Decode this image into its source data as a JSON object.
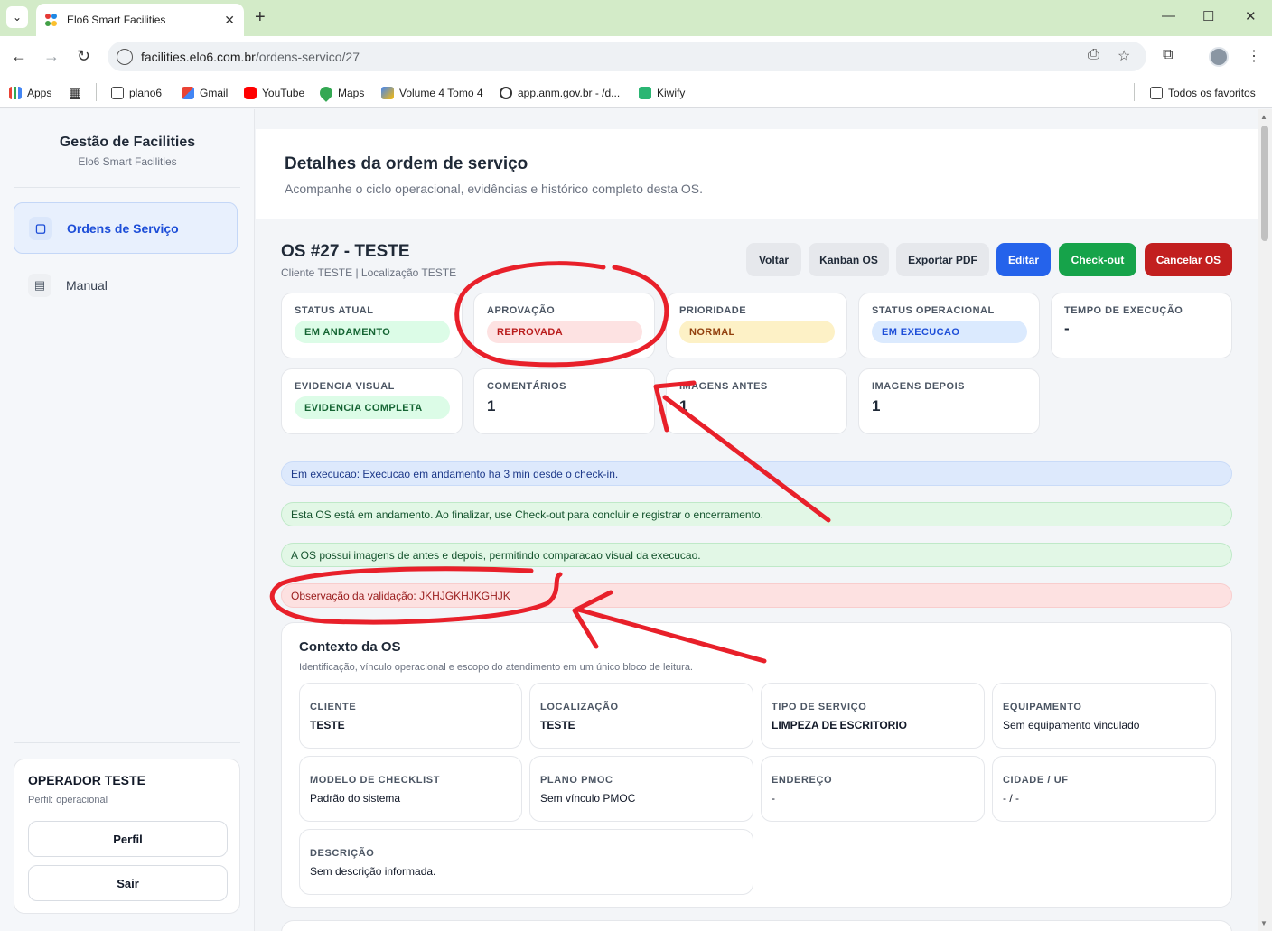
{
  "browser": {
    "tab_title": "Elo6 Smart Facilities",
    "url_host": "facilities.elo6.com.br",
    "url_path": "/ordens-servico/27",
    "bookmarks": [
      "Apps",
      "plano6",
      "Gmail",
      "YouTube",
      "Maps",
      "Volume 4 Tomo 4",
      "app.anm.gov.br - /d...",
      "Kiwify"
    ],
    "all_bookmarks": "Todos os favoritos"
  },
  "sidebar": {
    "title": "Gestão de Facilities",
    "subtitle": "Elo6 Smart Facilities",
    "items": [
      {
        "label": "Ordens de Serviço",
        "icon": "clipboard-icon"
      },
      {
        "label": "Manual",
        "icon": "document-icon"
      }
    ],
    "user": {
      "name": "OPERADOR TESTE",
      "role": "Perfil: operacional",
      "profile_label": "Perfil",
      "logout_label": "Sair"
    }
  },
  "header": {
    "title": "Detalhes da ordem de serviço",
    "subtitle": "Acompanhe o ciclo operacional, evidências e histórico completo desta OS."
  },
  "os": {
    "title": "OS #27 - TESTE",
    "subtitle": "Cliente TESTE | Localização TESTE",
    "actions": {
      "back": "Voltar",
      "kanban": "Kanban OS",
      "export": "Exportar PDF",
      "edit": "Editar",
      "checkout": "Check-out",
      "cancel": "Cancelar OS"
    }
  },
  "cards": {
    "status_atual": {
      "label": "STATUS ATUAL",
      "value": "EM ANDAMENTO"
    },
    "aprovacao": {
      "label": "APROVAÇÃO",
      "value": "REPROVADA"
    },
    "prioridade": {
      "label": "PRIORIDADE",
      "value": "NORMAL"
    },
    "status_operacional": {
      "label": "STATUS OPERACIONAL",
      "value": "EM EXECUCAO"
    },
    "tempo_execucao": {
      "label": "TEMPO DE EXECUÇÃO",
      "value": "-"
    },
    "evidencia_visual": {
      "label": "EVIDENCIA VISUAL",
      "value": "EVIDENCIA COMPLETA"
    },
    "comentarios": {
      "label": "COMENTÁRIOS",
      "value": "1"
    },
    "imagens_antes": {
      "label": "IMAGENS ANTES",
      "value": "1"
    },
    "imagens_depois": {
      "label": "IMAGENS DEPOIS",
      "value": "1"
    }
  },
  "alerts": {
    "execucao": "Em execucao: Execucao em andamento ha 3 min desde o check-in.",
    "andamento": "Esta OS está em andamento. Ao finalizar, use Check-out para concluir e registrar o encerramento.",
    "imagens": "A OS possui imagens de antes e depois, permitindo comparacao visual da execucao.",
    "validacao": "Observação da validação: JKHJGKHJKGHJK"
  },
  "contexto": {
    "title": "Contexto da OS",
    "description": "Identificação, vínculo operacional e escopo do atendimento em um único bloco de leitura.",
    "fields": {
      "cliente": {
        "label": "CLIENTE",
        "value": "TESTE"
      },
      "localizacao": {
        "label": "LOCALIZAÇÃO",
        "value": "TESTE"
      },
      "tipo_servico": {
        "label": "TIPO DE SERVIÇO",
        "value": "LIMPEZA DE ESCRITORIO"
      },
      "equipamento": {
        "label": "EQUIPAMENTO",
        "value": "Sem equipamento vinculado"
      },
      "modelo_checklist": {
        "label": "MODELO DE CHECKLIST",
        "value": "Padrão do sistema"
      },
      "plano_pmoc": {
        "label": "PLANO PMOC",
        "value": "Sem vínculo PMOC"
      },
      "endereco": {
        "label": "ENDEREÇO",
        "value": "-"
      },
      "cidade_uf": {
        "label": "CIDADE / UF",
        "value": "- / -"
      },
      "descricao": {
        "label": "DESCRIÇÃO",
        "value": "Sem descrição informada."
      }
    }
  },
  "colors": {
    "primary": "#2563eb",
    "success": "#16a34a",
    "danger": "#c21f1f",
    "annotation": "#e8202a"
  }
}
